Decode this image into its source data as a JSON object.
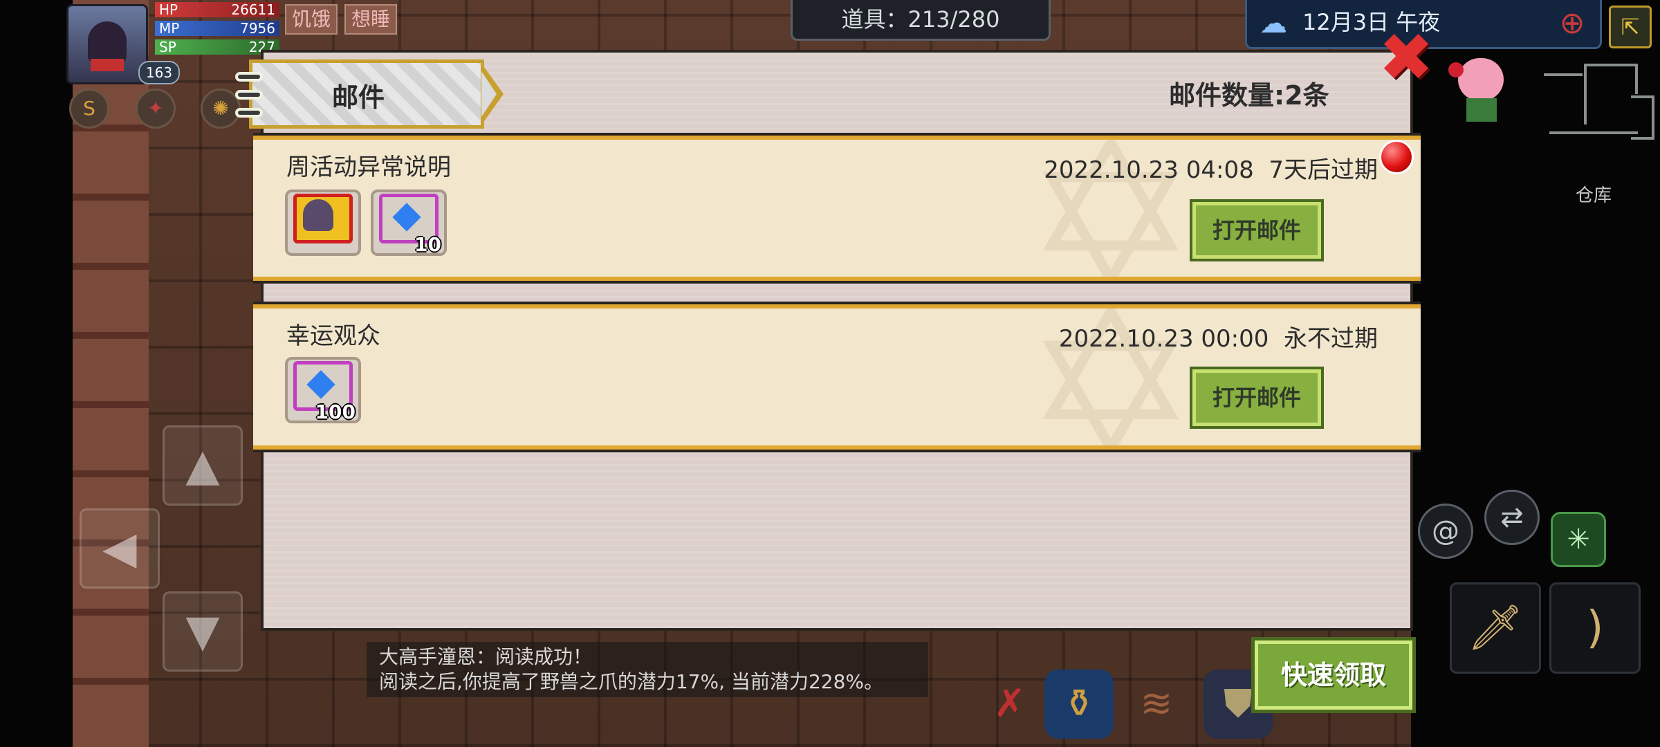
{
  "hud": {
    "hp_label": "HP",
    "hp_value": "26611",
    "mp_label": "MP",
    "mp_value": "7956",
    "sp_label": "SP",
    "sp_value": "227",
    "level": "163",
    "status_hungry": "饥饿",
    "status_sleepy": "想睡"
  },
  "top_bar": {
    "items_counter": "道具：213/280",
    "datetime": "12月3日 午夜",
    "warehouse_label": "仓库"
  },
  "mail": {
    "title": "邮件",
    "count_label": "邮件数量:2条",
    "items": [
      {
        "subject": "周活动异常说明",
        "date": "2022.10.23 04:08",
        "expiry": "7天后过期",
        "open_label": "打开邮件",
        "unread": true,
        "attachments": [
          {
            "type": "avatar-frame",
            "qty": ""
          },
          {
            "type": "diamond",
            "qty": "10"
          }
        ]
      },
      {
        "subject": "幸运观众",
        "date": "2022.10.23 00:00",
        "expiry": "永不过期",
        "open_label": "打开邮件",
        "unread": false,
        "attachments": [
          {
            "type": "diamond",
            "qty": "100"
          }
        ]
      }
    ],
    "quick_claim_label": "快速领取"
  },
  "chat_log": {
    "line1": "大高手潼恩：阅读成功！",
    "line2": "阅读之后,你提高了野兽之爪的潜力17%, 当前潜力228%。"
  },
  "colors": {
    "accent_gold": "#e0a830",
    "button_green": "#88b040",
    "close_red": "#e23030",
    "card_bg": "#f2e6cc"
  }
}
